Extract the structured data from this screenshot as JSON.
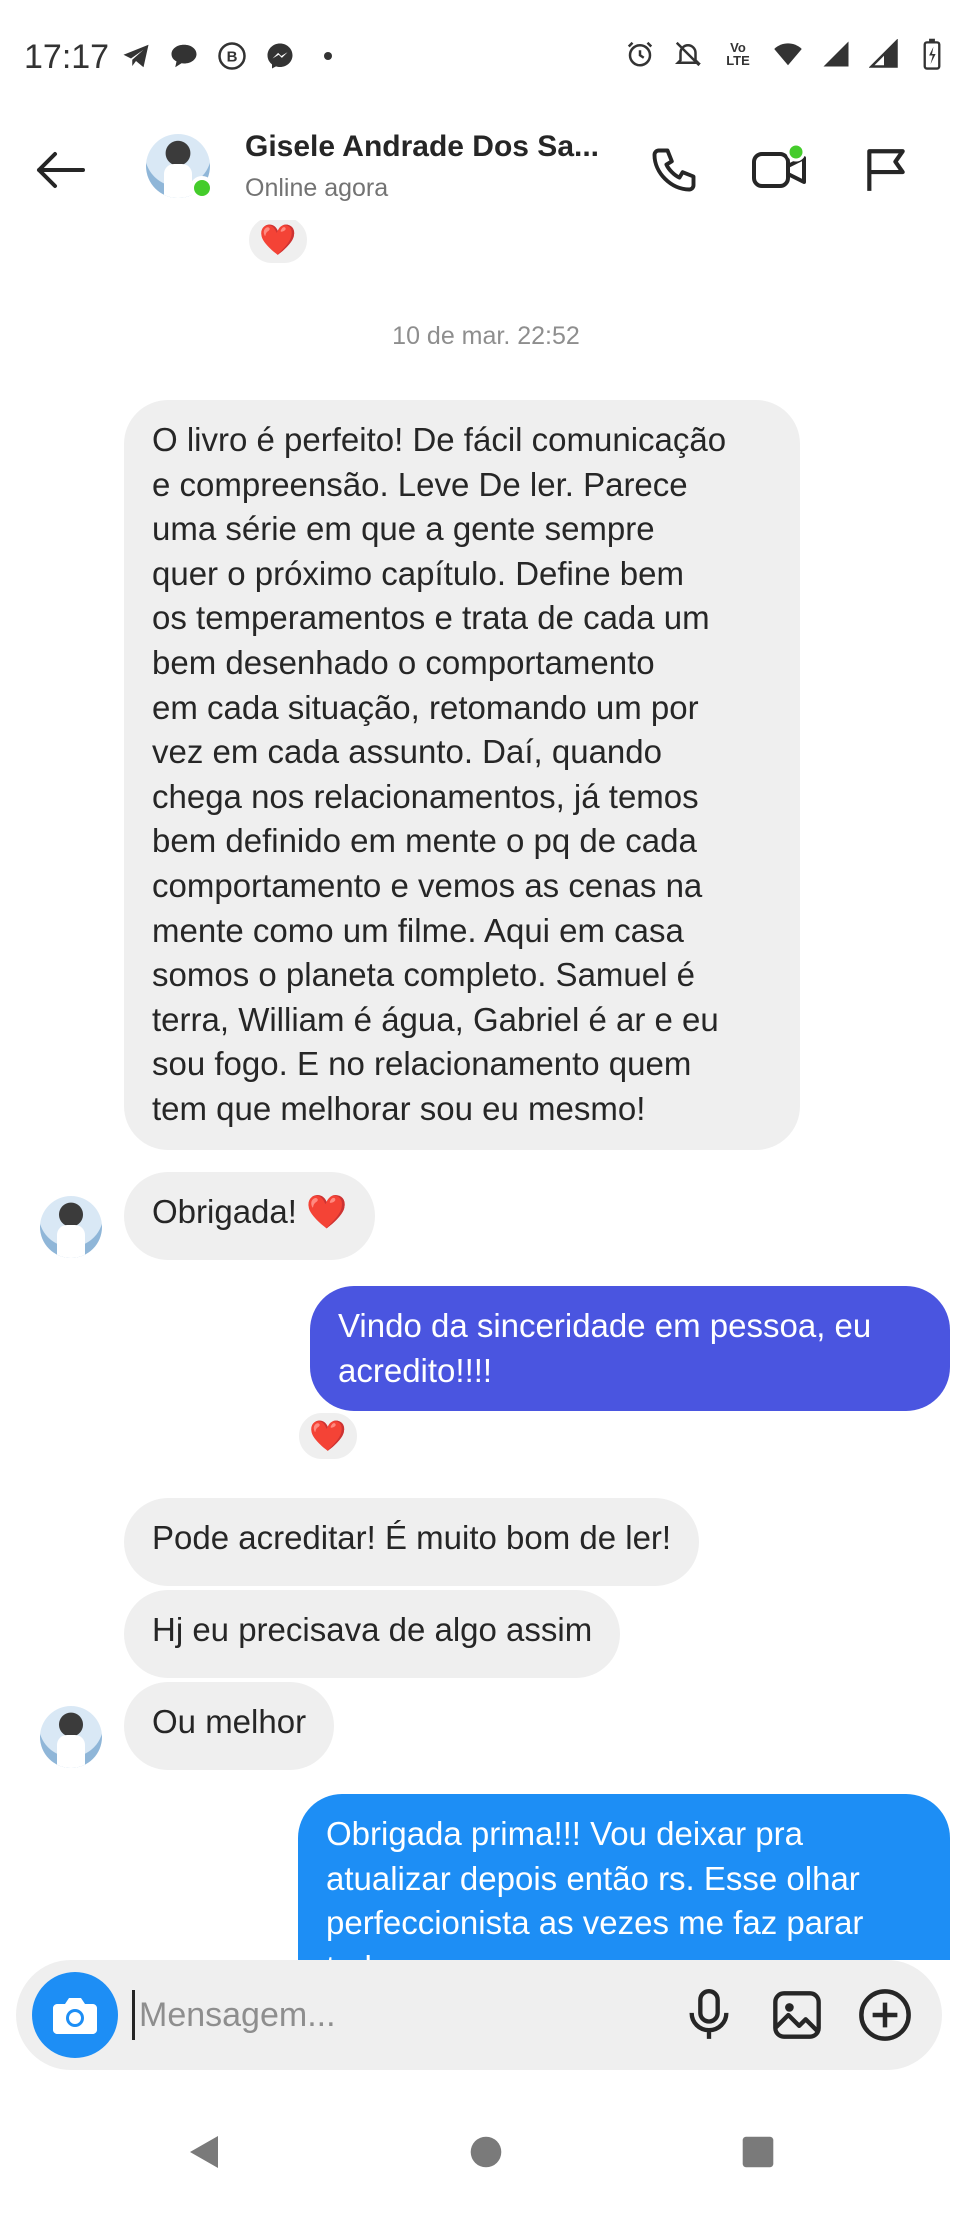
{
  "status_bar": {
    "time": "17:17",
    "left_icons": [
      "telegram-icon",
      "chat-icon",
      "b-icon",
      "messenger-icon",
      "dot-icon"
    ],
    "right_icons": [
      "alarm-icon",
      "muted-bell-icon",
      "volte-icon",
      "wifi-icon",
      "signal-icon",
      "signal-icon",
      "battery-icon"
    ],
    "volte_label": "Vo LTE"
  },
  "header": {
    "contact_name": "Gisele Andrade Dos Sa...",
    "contact_status": "Online agora",
    "online_color": "#44cc2b"
  },
  "messages": {
    "top_reaction": "❤️",
    "timestamp": "10 de mar. 22:52",
    "msg1_lines": [
      "O livro é perfeito! De fácil comunicação",
      "e compreensão. Leve De ler. Parece",
      "uma série em que a gente sempre",
      "quer o próximo capítulo. Define bem",
      "os temperamentos e trata de cada um",
      "bem desenhado o comportamento",
      "em cada situação, retomando um por",
      "vez em cada assunto. Daí, quando",
      "chega nos relacionamentos, já temos",
      "bem definido em mente o pq de cada",
      "comportamento e vemos as cenas na",
      "mente como um filme. Aqui em casa",
      "somos o planeta completo. Samuel é",
      "terra, William é água, Gabriel é ar e eu",
      "sou fogo. E no relacionamento quem",
      "tem que melhorar sou eu mesmo!"
    ],
    "msg2": "Obrigada! ❤️",
    "msg3_lines": [
      "Vindo da sinceridade em pessoa, eu",
      "acredito!!!!"
    ],
    "msg3_reaction": "❤️",
    "msg4": "Pode acreditar! É muito bom de ler!",
    "msg5": "Hj eu precisava de algo assim",
    "msg6": "Ou melhor",
    "msg7_lines": [
      "Obrigada prima!!! Vou deixar pra",
      "atualizar depois então rs. Esse olhar",
      "perfeccionista as vezes me faz parar",
      "tudo"
    ],
    "incoming_color": "#efefef",
    "outgoing_color_1": "#4a55e0",
    "outgoing_color_2": "#1d8ef5"
  },
  "composer": {
    "placeholder": "Mensagem...",
    "accent": "#1d8ef5"
  }
}
